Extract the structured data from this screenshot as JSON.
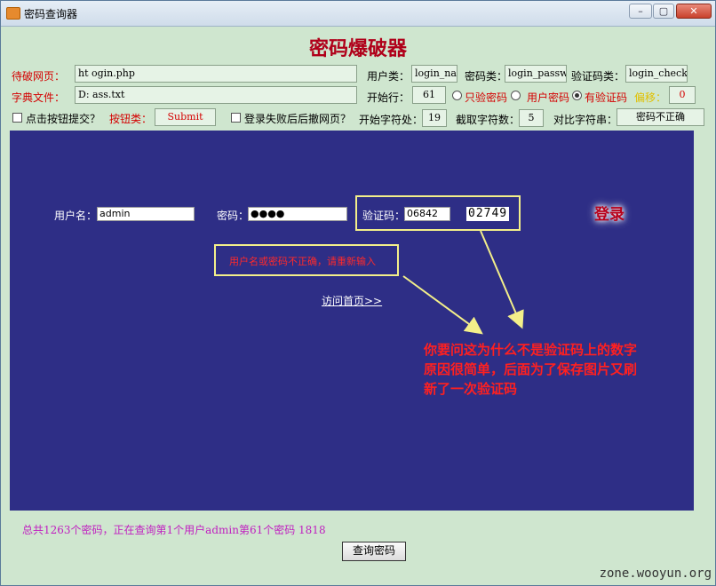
{
  "window": {
    "title": "密码查询器",
    "btn_min": "–",
    "btn_max": "▢",
    "btn_close": "✕"
  },
  "app": {
    "heading": "密码爆破器"
  },
  "form": {
    "target_label": "待破网页：",
    "target_value": "ht                                                     ogin.php",
    "user_label": "用户类：",
    "user_value": "login_na",
    "pass_label": "密码类：",
    "pass_value": "login_passw",
    "captcha_label": "验证码类：",
    "captcha_value": "login_check",
    "dict_label": "字典文件：",
    "dict_value": "D:                                                ass.txt",
    "start_row_label": "开始行：",
    "start_row_value": "61",
    "radio_pass_only": "只验密码",
    "radio_user_pass": "用户密码",
    "radio_captcha": "有验证码",
    "offset_label": "偏移：",
    "offset_value": "0",
    "click_submit_label": "点击按钮提交？",
    "button_class_label": "按钮类：",
    "button_class_value": "Submit",
    "rollback_label": "登录失败后后撤网页？",
    "start_char_label": "开始字符处：",
    "start_char_value": "19",
    "cut_count_label": "截取字符数：",
    "cut_count_value": "5",
    "compare_label": "对比字符串：",
    "compare_value": "密码不正确"
  },
  "browser": {
    "username_label": "用户名：",
    "username_value": "admin",
    "password_label": "密码：",
    "password_value": "●●●●",
    "captcha_label": "验证码：",
    "captcha_value": "06842",
    "captcha_image": "02749",
    "login_text": "登录",
    "error_msg": "用户名或密码不正确，请重新输入",
    "home_link": "访问首页>>",
    "note": [
      "你要问这为什么不是验证码上的数字",
      "原因很简单，后面为了保存图片又刷",
      "新了一次验证码"
    ]
  },
  "status": {
    "text": "总共1263个密码，正在查询第1个用户admin第61个密码 1818"
  },
  "query_button": "查询密码",
  "watermark": "zone.wooyun.org"
}
